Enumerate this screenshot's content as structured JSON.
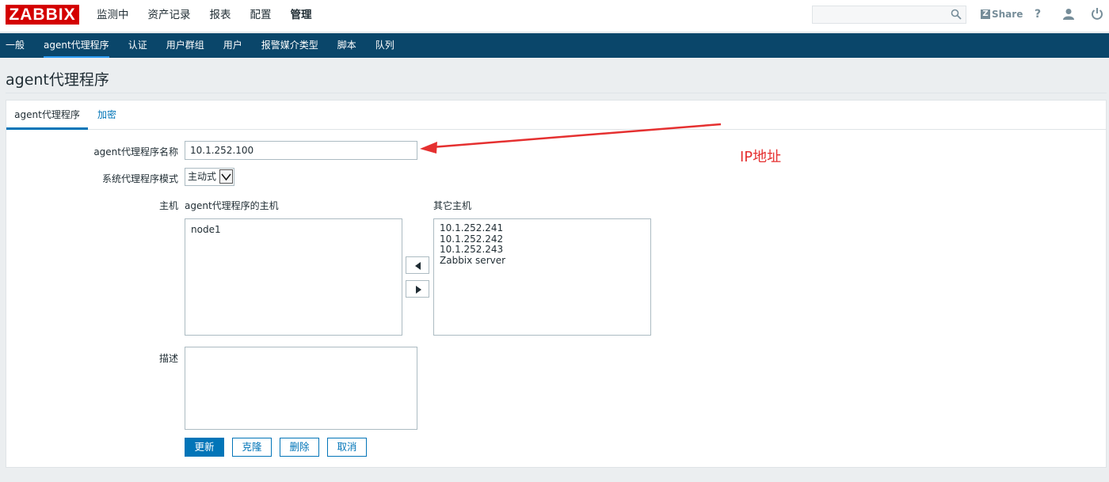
{
  "logo": "ZABBIX",
  "top_menu": [
    {
      "label": "监测中"
    },
    {
      "label": "资产记录"
    },
    {
      "label": "报表"
    },
    {
      "label": "配置"
    },
    {
      "label": "管理"
    }
  ],
  "header_right": {
    "share_label": "Share",
    "help_label": "?"
  },
  "sub_nav": [
    {
      "label": "一般"
    },
    {
      "label": "agent代理程序"
    },
    {
      "label": "认证"
    },
    {
      "label": "用户群组"
    },
    {
      "label": "用户"
    },
    {
      "label": "报警媒介类型"
    },
    {
      "label": "脚本"
    },
    {
      "label": "队列"
    }
  ],
  "page_title": "agent代理程序",
  "tabs": {
    "active": "agent代理程序",
    "inactive": "加密"
  },
  "form": {
    "name_label": "agent代理程序名称",
    "name_value": "10.1.252.100",
    "mode_label": "系统代理程序模式",
    "mode_value": "主动式",
    "hosts_label": "主机",
    "proxy_hosts_label": "agent代理程序的主机",
    "other_hosts_label": "其它主机",
    "proxy_hosts": [
      "node1"
    ],
    "other_hosts": [
      "10.1.252.241",
      "10.1.252.242",
      "10.1.252.243",
      "Zabbix server"
    ],
    "description_label": "描述",
    "description_value": ""
  },
  "buttons": {
    "update": "更新",
    "clone": "克隆",
    "delete": "删除",
    "cancel": "取消"
  },
  "annotation": {
    "text": "IP地址",
    "color": "#e53030"
  },
  "colors": {
    "brand_red": "#d40000",
    "nav_bg": "#0a466a",
    "accent": "#0275b8"
  }
}
